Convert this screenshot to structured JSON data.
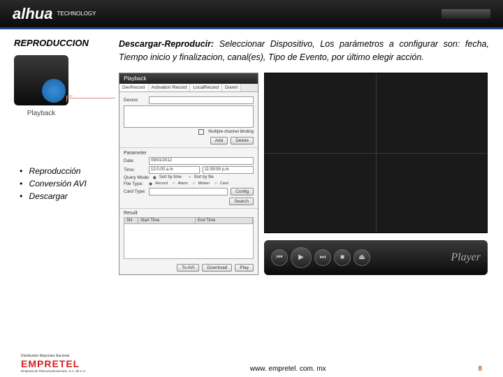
{
  "header": {
    "brand": "alhua",
    "brand_sub": "TECHNOLOGY"
  },
  "side": {
    "title": "REPRODUCCION",
    "playback_label": "Playback",
    "bullets": [
      "Reproducción",
      "Conversión AVI",
      "Descargar"
    ]
  },
  "desc": {
    "lead": "Descargar-Reproducir:",
    "rest": " Seleccionar Dispositivo, Los parámetros a configurar son: fecha, Tiempo inicio y finalizacion, canal(es), Tipo de Evento, por último elegir acción."
  },
  "panel": {
    "title": "Playback",
    "tabs": [
      "DevRecord",
      "Activation Record",
      "LocalRecord",
      "Downl"
    ],
    "device_label": "Device:",
    "multi": "Multiple-channel binding",
    "add": "Add",
    "del": "Delete",
    "param": "Parameter",
    "date_label": "Date:",
    "date_val": "09/01/2012",
    "time_label": "Time:",
    "time_from": "12:0.00 a.m",
    "time_to": "11:59:59 p.m",
    "qmode": "Query Mode:",
    "q1": "Sort by time",
    "q2": "Sort by file",
    "ftype": "File Type:",
    "f1": "Record",
    "f2": "Alarm",
    "f3": "Motion",
    "f4": "Card",
    "ctype": "Card Type:",
    "config": "Config",
    "search": "Search",
    "result": "Result",
    "c1": "SN",
    "c2": "Start Time",
    "c3": "End Time",
    "b1": "To AVI",
    "b2": "Download",
    "b3": "Play"
  },
  "player": {
    "label": "Player"
  },
  "footer": {
    "dist": "Distribuidor Mayorista Nacional",
    "brand": "EMPRETEL",
    "sub": "Empresa de Telecomunicaciones, S.A. de C.V.",
    "url": "www. empretel. com. mx",
    "page": "8"
  }
}
